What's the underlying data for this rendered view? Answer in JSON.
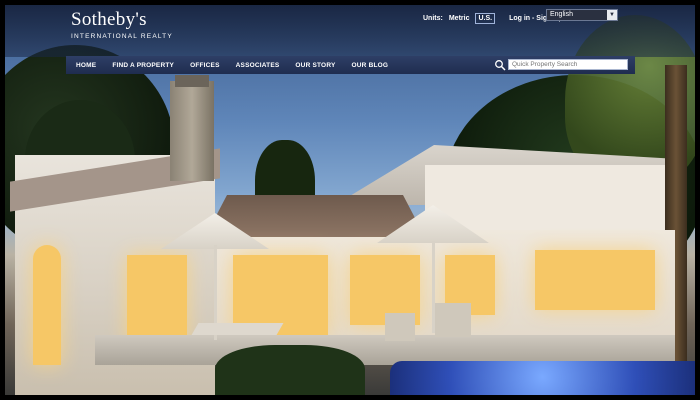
{
  "brand": {
    "name": "Sotheby's",
    "subtitle": "INTERNATIONAL REALTY"
  },
  "utility": {
    "units_label": "Units:",
    "metric": "Metric",
    "us": "U.S.",
    "login": "Log in - Sign Up",
    "language": "English"
  },
  "nav": {
    "items": [
      "HOME",
      "FIND A PROPERTY",
      "OFFICES",
      "ASSOCIATES",
      "OUR STORY",
      "OUR BLOG"
    ]
  },
  "search": {
    "placeholder": "Quick Property Search",
    "icon": "search-icon"
  },
  "colors": {
    "nav_bg": "#1f2d4f",
    "header_text": "#ffffff"
  }
}
